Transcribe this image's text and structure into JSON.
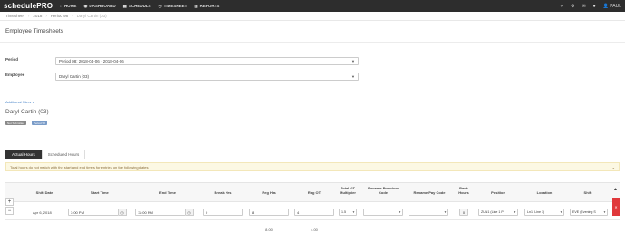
{
  "navbar": {
    "logo": "schedulePRO",
    "items": [
      {
        "icon": "home-icon",
        "label": "HOME"
      },
      {
        "icon": "dashboard-icon",
        "label": "DASHBOARD"
      },
      {
        "icon": "calendar-icon",
        "label": "SCHEDULE"
      },
      {
        "icon": "clock-icon",
        "label": "TIMESHEET"
      },
      {
        "icon": "bar-chart-icon",
        "label": "REPORTS"
      }
    ],
    "user": "PAUL"
  },
  "breadcrumb": [
    "Timesheet",
    "2018",
    "Period 98",
    "Daryl Cartin (03)"
  ],
  "page": {
    "title": "Employee Timesheets",
    "period_label": "Period",
    "period_value": "Period 98: 2018-04-06 - 2018-04-06",
    "employee_label": "Employee",
    "employee_value": "Daryl Cartin (03)",
    "filters_link": "Additional filters ▾",
    "employee_name": "Daryl Cartin (03)",
    "badge_status": "Not Submitted",
    "badge_period": "Period 98"
  },
  "tabs": {
    "actual": "Actual Hours",
    "scheduled": "Scheduled Hours"
  },
  "warning": "Total hours do not match with the start and end times for entries on the following dates:",
  "table": {
    "headers": [
      "Shift Date",
      "Start Time",
      "End Time",
      "Break Hrs",
      "Reg Hrs",
      "Reg OT",
      "Total OT Multiplier",
      "Rename Premium Code",
      "Rename Pay Code",
      "Bank Hours",
      "Position",
      "Location",
      "Shift"
    ],
    "row": {
      "date": "Apr 6, 2018",
      "start": "3:00 PM",
      "end": "11:00 PM",
      "break": "0",
      "reg_hrs": "8",
      "reg_ot": "4",
      "multiplier": "1.5",
      "premium": "",
      "paycode": "",
      "bank": "0",
      "position": "ZUN1 (Line 1 P",
      "location": "Ln1 (Line 1)",
      "shift": "EVE (Evening S"
    },
    "totals": {
      "reg_hrs": "8.00",
      "reg_ot": "4.00"
    }
  }
}
